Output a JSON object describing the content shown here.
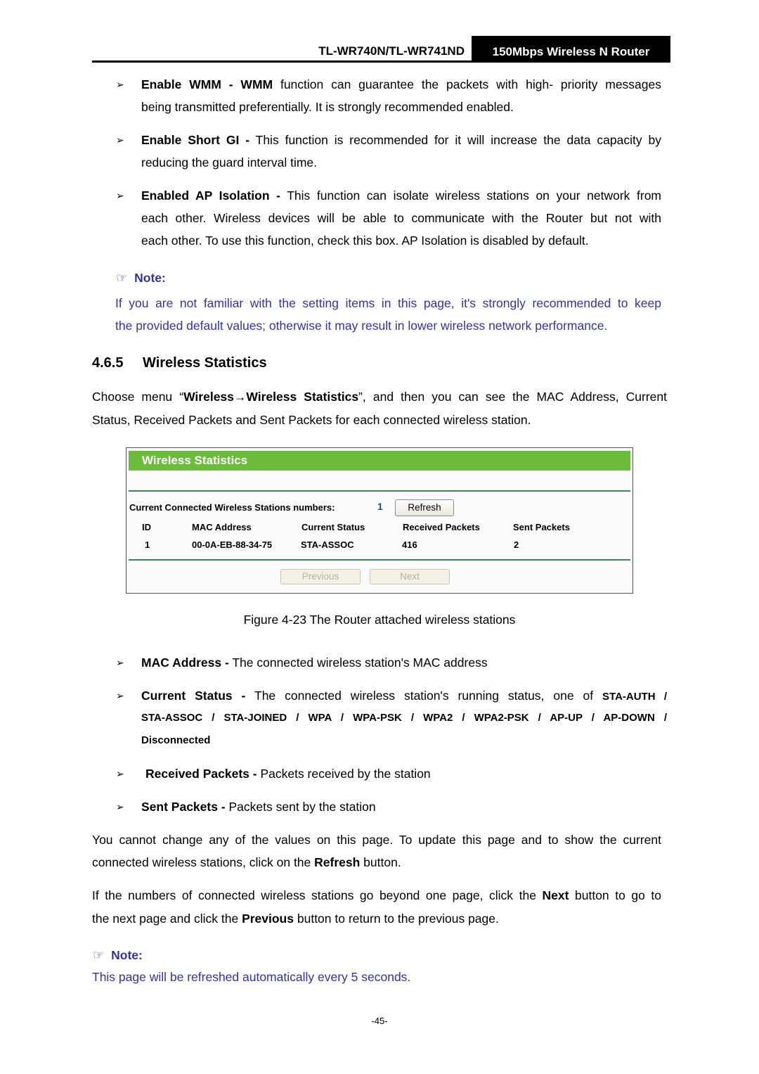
{
  "header": {
    "model": "TL-WR740N/TL-WR741ND",
    "product": "150Mbps Wireless N Router"
  },
  "bullets_top": [
    {
      "term": "Enable WMM - WMM",
      "line1": " function can guarantee the packets with high- priority messages",
      "line2": "being transmitted preferentially. It is strongly recommended enabled."
    },
    {
      "term": "Enable Short GI -",
      "line1": " This function is recommended for it will increase the data capacity by",
      "line2": "reducing the guard interval time."
    },
    {
      "term": "Enabled AP Isolation -",
      "line1": " This function can isolate wireless stations on your network from",
      "line2": "each other. Wireless devices will be able to communicate with the Router but not with",
      "line3": "each other. To use this function, check this box. AP Isolation is disabled by default."
    }
  ],
  "note1": {
    "label": "Note:",
    "line1": "If you are not familiar with the setting items in this page, it's strongly recommended to keep",
    "line2": "the provided default values; otherwise it may result in lower wireless network performance."
  },
  "section": {
    "number": "4.6.5",
    "title": "Wireless Statistics",
    "intro_pre": "Choose menu “",
    "intro_bold": "Wireless→Wireless Statistics",
    "intro_post": "”, and then you can see the MAC Address, Current",
    "intro_line2": "Status, Received Packets and Sent Packets for each connected wireless station."
  },
  "figure": {
    "panel_title": "Wireless Statistics",
    "count_label": "Current Connected Wireless Stations numbers:",
    "count_value": "1",
    "refresh_label": "Refresh",
    "columns": [
      "ID",
      "MAC Address",
      "Current Status",
      "Received Packets",
      "Sent Packets"
    ],
    "rows": [
      [
        "1",
        "00-0A-EB-88-34-75",
        "STA-ASSOC",
        "416",
        "2"
      ]
    ],
    "previous_label": "Previous",
    "next_label": "Next",
    "caption": "Figure 4-23 The Router attached wireless stations",
    "header_color": "#6cbb3c"
  },
  "bullets_bottom": {
    "mac": {
      "term": "MAC Address -",
      "text": " The connected wireless station's MAC address"
    },
    "status": {
      "term": "Current Status -",
      "text": " The connected wireless station's running status, one of ",
      "values_line1": "STA-AUTH /",
      "values_line2": "STA-ASSOC  /  STA-JOINED  /  WPA  /  WPA-PSK  /  WPA2  /  WPA2-PSK  /  AP-UP  /  AP-DOWN  /",
      "values_line3": "Disconnected"
    },
    "received": {
      "term": "Received Packets -",
      "text": " Packets received by the station"
    },
    "sent": {
      "term": "Sent Packets -",
      "text": " Packets sent by the station"
    }
  },
  "para1": {
    "line1": "You cannot change any of the values on this page. To update this page and to show the current",
    "line2_pre": "connected wireless stations, click on the ",
    "line2_bold": "Refresh",
    "line2_post": " button."
  },
  "para2": {
    "line1_pre": "If the numbers of connected wireless stations go beyond one page, click the ",
    "line1_bold": "Next",
    "line1_post": " button to go to",
    "line2_pre": "the next page and click the ",
    "line2_bold": "Previous",
    "line2_post": " button to return to the previous page."
  },
  "note2": {
    "label": "Note:",
    "text": "This page will be refreshed automatically every 5 seconds."
  },
  "page_number": "-45-",
  "icons": {
    "bullet": "➢",
    "note": "☞"
  },
  "colors": {
    "note_text": "#3333a0",
    "panel_green": "#6cbb3c",
    "rule_green": "#3c8a52"
  }
}
